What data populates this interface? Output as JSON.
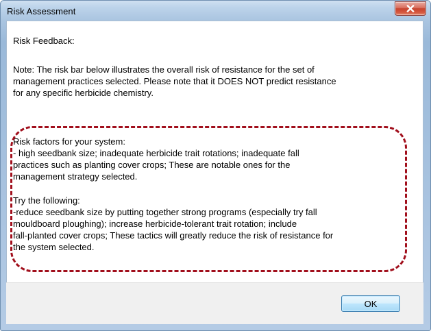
{
  "window": {
    "title": "Risk Assessment"
  },
  "content": {
    "heading": "Risk Feedback:",
    "note_lines": [
      "Note: The risk bar below illustrates the overall risk of resistance for the set of",
      "management practices selected. Please note that it DOES NOT predict resistance",
      "for any specific herbicide chemistry."
    ],
    "risk_factors": {
      "title": "Risk factors for your system:",
      "lines": [
        "- high seedbank size; inadequate herbicide trait rotations; inadequate fall",
        "practices such as planting cover crops; These are notable ones for the",
        "management strategy selected."
      ]
    },
    "try_following": {
      "title": "Try the following:",
      "lines": [
        "-reduce seedbank size by putting together strong programs (especially try fall",
        "mouldboard ploughing); increase herbicide-tolerant trait rotation; include",
        "fall-planted cover crops; These tactics will greatly reduce the risk of resistance for",
        "the system selected."
      ]
    }
  },
  "buttons": {
    "ok_label": "OK",
    "close_icon": "close-icon"
  },
  "colors": {
    "highlight_border": "#a10f1c",
    "close_button": "#c7442e",
    "ok_border": "#3c7fb1"
  }
}
